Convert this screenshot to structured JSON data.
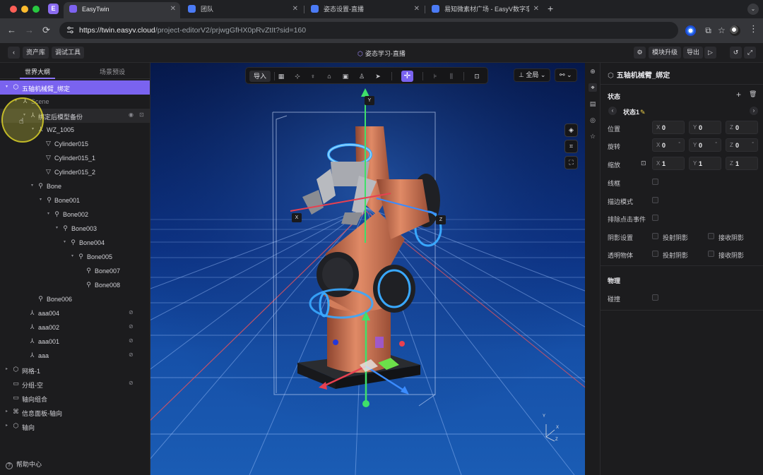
{
  "browser": {
    "ext_badge": "E",
    "tabs": [
      {
        "title": "EasyTwin",
        "close": "✕"
      },
      {
        "title": "团队",
        "close": "✕"
      },
      {
        "title": "姿态设置-直播",
        "close": "✕"
      },
      {
        "title": "易知微素材广场 - EasyV数字孪",
        "close": "✕"
      }
    ],
    "new_tab": "+",
    "url_host": "https://twin.easyv.cloud",
    "url_path": "/project-editorV2/prjwgGfHX0pRvZtIt?sid=160"
  },
  "app": {
    "title": "姿态学习-直播",
    "asset_lib": "资产库",
    "debug_tool": "调试工具",
    "upgrade": "模块升级",
    "export": "导出"
  },
  "left": {
    "tab_world": "世界大纲",
    "tab_scene": "场景预设",
    "tree": [
      {
        "label": "五轴机械臂_绑定"
      },
      {
        "label": "Scene"
      },
      {
        "label": "绑定后模型备份"
      },
      {
        "label": "WZ_1005"
      },
      {
        "label": "Cylinder015"
      },
      {
        "label": "Cylinder015_1"
      },
      {
        "label": "Cylinder015_2"
      },
      {
        "label": "Bone"
      },
      {
        "label": "Bone001"
      },
      {
        "label": "Bone002"
      },
      {
        "label": "Bone003"
      },
      {
        "label": "Bone004"
      },
      {
        "label": "Bone005"
      },
      {
        "label": "Bone007"
      },
      {
        "label": "Bone008"
      },
      {
        "label": "Bone006"
      },
      {
        "label": "aaa004"
      },
      {
        "label": "aaa002"
      },
      {
        "label": "aaa001"
      },
      {
        "label": "aaa"
      },
      {
        "label": "网格-1"
      },
      {
        "label": "分组-空"
      },
      {
        "label": "轴向组合"
      },
      {
        "label": "信息面板-轴向"
      },
      {
        "label": "轴向"
      }
    ],
    "help": "帮助中心"
  },
  "viewport": {
    "import": "导入",
    "view_mode": "全局",
    "axis_y": "Y",
    "axis_x": "X",
    "axis_z": "Z",
    "mini_y": "Y",
    "mini_x": "X",
    "mini_z": "Z"
  },
  "right": {
    "title": "五轴机械臂_绑定",
    "section_state": "状态",
    "state_name": "状态1",
    "position": {
      "label": "位置",
      "x": "0",
      "y": "0",
      "z": "0"
    },
    "rotation": {
      "label": "旋转",
      "x": "0",
      "y": "0",
      "z": "0",
      "unit": "°"
    },
    "scale": {
      "label": "缩放",
      "x": "1",
      "y": "1",
      "z": "1"
    },
    "axis_x": "X",
    "axis_y": "Y",
    "axis_z": "Z",
    "wireframe": "线框",
    "outline_mode": "描边模式",
    "exclude_click": "排除点击事件",
    "shadow_settings": "阴影设置",
    "transparent": "透明物体",
    "cast_shadow": "投射阴影",
    "receive_shadow": "接收阴影",
    "section_physics": "物理",
    "collision": "碰撞"
  },
  "colors": {
    "accent": "#7a63ef",
    "panel": "#1c1c1e",
    "viewport_top": "#06184a",
    "viewport_bottom": "#1a5cb4",
    "robot": "#c8704f",
    "glow": "#39a8ff"
  }
}
